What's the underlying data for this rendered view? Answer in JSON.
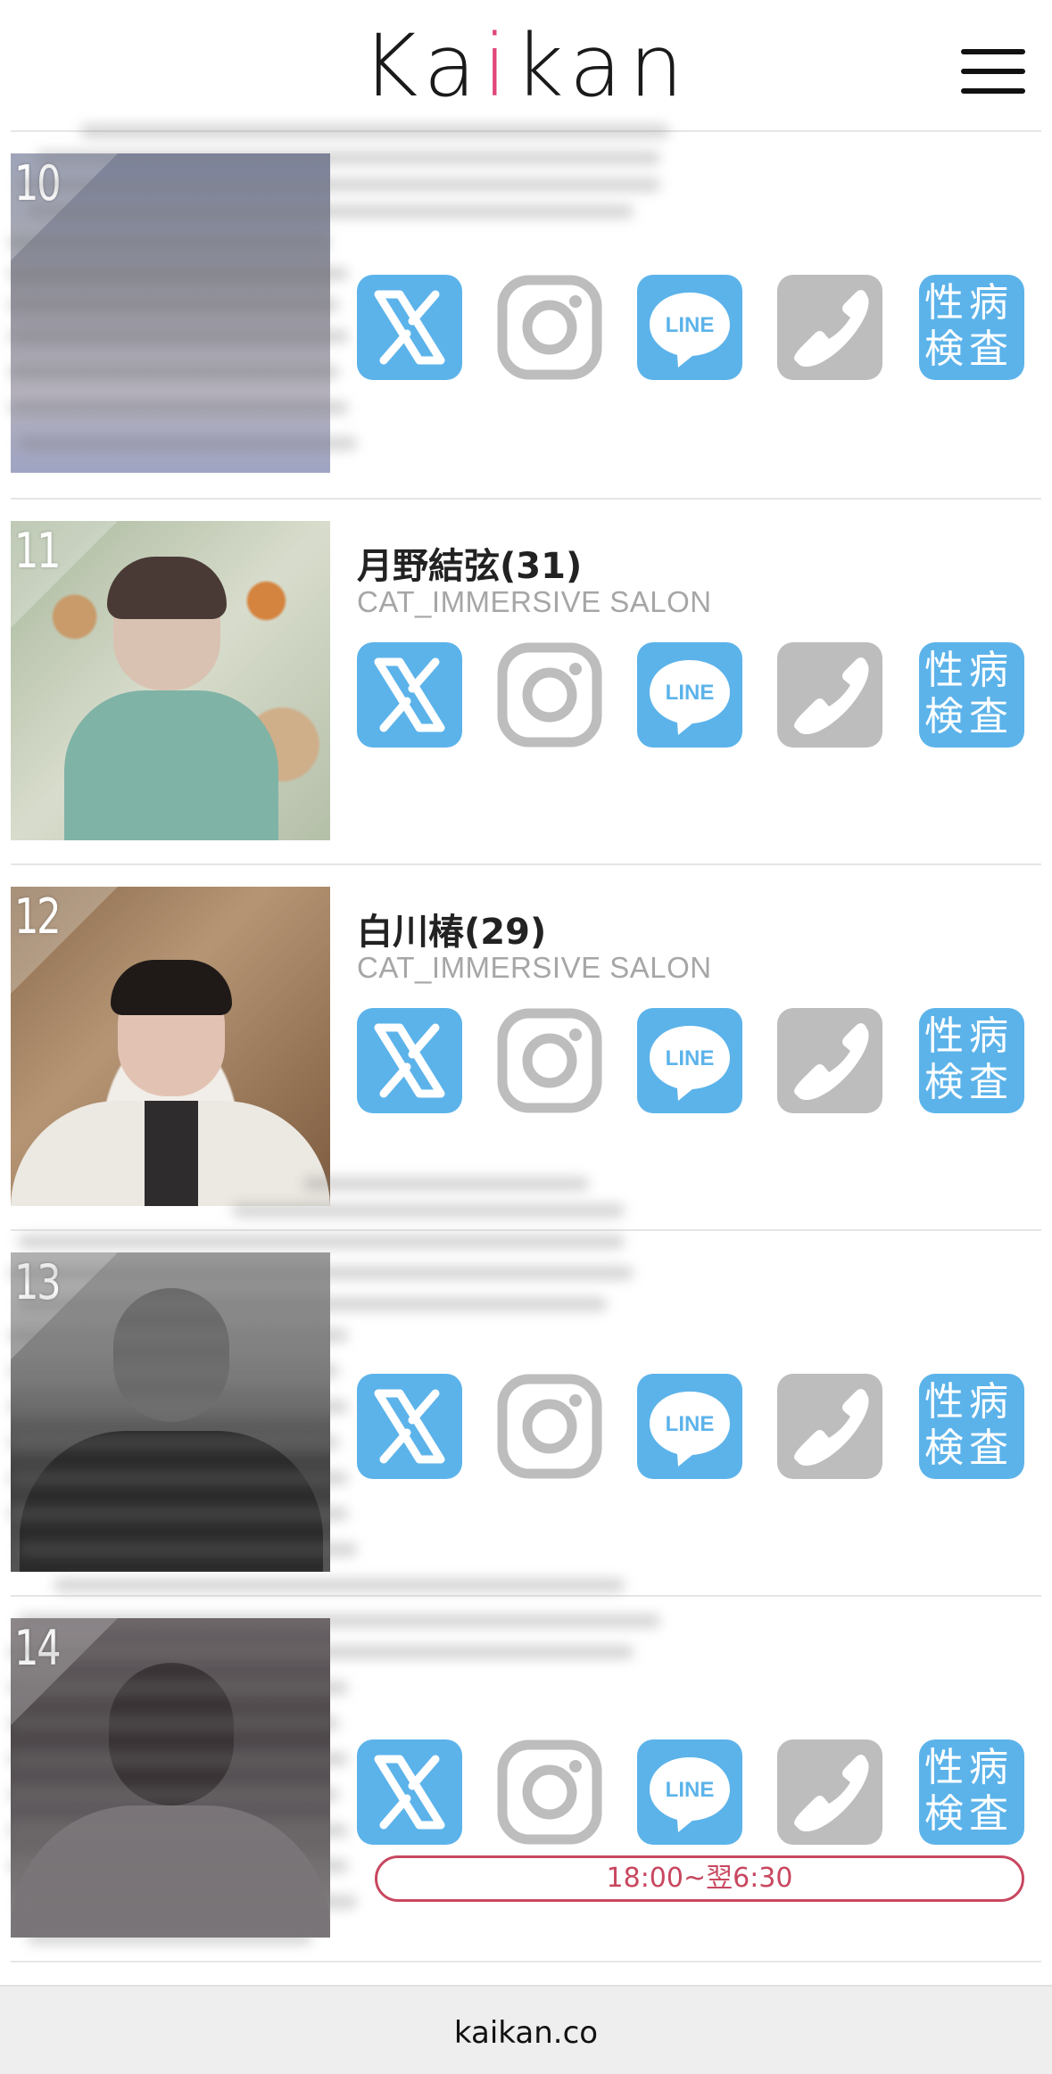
{
  "header": {
    "logo_prefix": "Ka",
    "logo_accent": "i",
    "logo_suffix": "kan"
  },
  "icons": {
    "x": "x-icon",
    "instagram": "instagram-icon",
    "line": "line-icon",
    "phone": "phone-icon",
    "std_test": "std-test-icon",
    "line_text": "LINE",
    "std_text_1": "性病",
    "std_text_2": "検査"
  },
  "colors": {
    "accent_blue": "#5cb3ea",
    "inactive_gray": "#bdbdbd",
    "logo_pink": "#e0457b",
    "hours_red": "#c8475f"
  },
  "entries": [
    {
      "rank": "10",
      "name": "",
      "shop": ""
    },
    {
      "rank": "11",
      "name": "月野結弦(31)",
      "shop": "CAT_IMMERSIVE SALON"
    },
    {
      "rank": "12",
      "name": "白川椿(29)",
      "shop": "CAT_IMMERSIVE SALON"
    },
    {
      "rank": "13",
      "name": "",
      "shop": ""
    },
    {
      "rank": "14",
      "name": "",
      "shop": "",
      "hours": "18:00~翌6:30"
    }
  ],
  "footer": {
    "domain": "kaikan.co"
  }
}
